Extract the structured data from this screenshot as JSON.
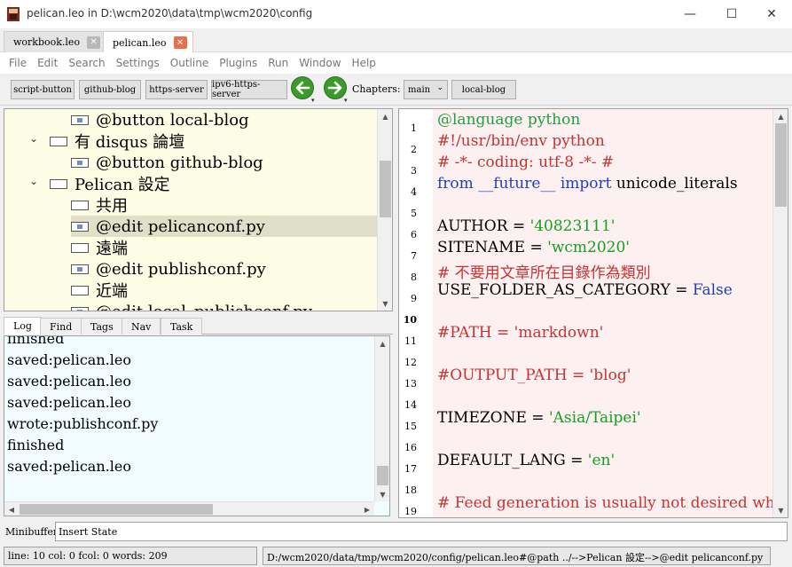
{
  "window": {
    "title": "pelican.leo in D:\\wcm2020\\data\\tmp\\wcm2020\\config",
    "minimize_glyph": "—",
    "maximize_glyph": "☐",
    "close_glyph": "✕"
  },
  "doc_tabs": [
    {
      "label": "workbook.leo",
      "close": "✕"
    },
    {
      "label": "pelican.leo",
      "close": "✕"
    }
  ],
  "menu": [
    "File",
    "Edit",
    "Search",
    "Settings",
    "Outline",
    "Plugins",
    "Run",
    "Window",
    "Help"
  ],
  "toolbar": {
    "buttons": [
      "script-button",
      "github-blog",
      "https-server",
      "ipv6-https-server"
    ],
    "chapters_label": "Chapters:",
    "chapter_select": "main",
    "chapter_button": "local-blog",
    "select_arrow": "⌄",
    "nav_drop": "▾"
  },
  "outline": {
    "nodes": [
      {
        "twisty": "",
        "icon": "body",
        "text": "@button local-blog"
      },
      {
        "twisty": "⌄",
        "icon": "empty",
        "text": "有 disqus 論壇"
      },
      {
        "twisty": "",
        "icon": "body",
        "text": "@button github-blog"
      },
      {
        "twisty": "⌄",
        "icon": "empty",
        "text": "Pelican 設定"
      },
      {
        "twisty": "",
        "icon": "empty",
        "text": "共用"
      },
      {
        "twisty": "",
        "icon": "body",
        "text": "@edit pelicanconf.py"
      },
      {
        "twisty": "",
        "icon": "empty",
        "text": "遠端"
      },
      {
        "twisty": "",
        "icon": "body",
        "text": "@edit publishconf.py"
      },
      {
        "twisty": "",
        "icon": "empty",
        "text": "近端"
      },
      {
        "twisty": "",
        "icon": "body",
        "text": "@edit local_publishconf.py"
      }
    ],
    "selected_index": 5,
    "scroll": {
      "up": "▲",
      "down": "▼"
    }
  },
  "log_tabs": [
    "Log",
    "Find",
    "Tags",
    "Nav",
    "Task"
  ],
  "log": {
    "lines": [
      "finished",
      "saved:pelican.leo",
      "saved:pelican.leo",
      "saved:pelican.leo",
      "wrote:publishconf.py",
      "finished",
      "saved:pelican.leo"
    ],
    "scroll": {
      "up": "▲",
      "down": "▼",
      "left": "◀",
      "right": "▶"
    }
  },
  "body": {
    "line_numbers": [
      "1",
      "2",
      "3",
      "4",
      "5",
      "6",
      "7",
      "8",
      "9",
      "10",
      "11",
      "12",
      "13",
      "14",
      "15",
      "16",
      "17",
      "18",
      "19"
    ],
    "current_line": "10",
    "lines": [
      [
        {
          "t": "@language python",
          "c": "dir"
        }
      ],
      [
        {
          "t": "#!/usr/bin/env python",
          "c": "com"
        }
      ],
      [
        {
          "t": "# -*- coding: utf-8 -*- #",
          "c": "com"
        }
      ],
      [
        {
          "t": "from",
          "c": "kw"
        },
        {
          "t": " ",
          "c": "txt"
        },
        {
          "t": "__future__",
          "c": "kw"
        },
        {
          "t": " ",
          "c": "txt"
        },
        {
          "t": "import",
          "c": "kw"
        },
        {
          "t": " unicode_literals",
          "c": "txt"
        }
      ],
      [],
      [
        {
          "t": "AUTHOR = ",
          "c": "txt"
        },
        {
          "t": "'40823111'",
          "c": "str"
        }
      ],
      [
        {
          "t": "SITENAME = ",
          "c": "txt"
        },
        {
          "t": "'wcm2020'",
          "c": "str"
        }
      ],
      [
        {
          "t": "# 不要用文章所在目錄作為類別",
          "c": "com"
        }
      ],
      [
        {
          "t": "USE_FOLDER_AS_CATEGORY = ",
          "c": "txt"
        },
        {
          "t": "False",
          "c": "kw"
        }
      ],
      [],
      [
        {
          "t": "#PATH = 'markdown'",
          "c": "com"
        }
      ],
      [],
      [
        {
          "t": "#OUTPUT_PATH = 'blog'",
          "c": "com"
        }
      ],
      [],
      [
        {
          "t": "TIMEZONE = ",
          "c": "txt"
        },
        {
          "t": "'Asia/Taipei'",
          "c": "str"
        }
      ],
      [],
      [
        {
          "t": "DEFAULT_LANG = ",
          "c": "txt"
        },
        {
          "t": "'en'",
          "c": "str"
        }
      ],
      [],
      [
        {
          "t": "# Feed generation is usually not desired when",
          "c": "com"
        }
      ]
    ],
    "scroll": {
      "up": "▲",
      "down": "▼"
    }
  },
  "minibuffer": {
    "label": "Minibuffer:",
    "value": "Insert State"
  },
  "status": {
    "left": "line: 10 col: 0  fcol: 0 words: 209",
    "right": "D:/wcm2020/data/tmp/wcm2020/config/pelican.leo#@path ../-->Pelican 設定-->@edit pelicanconf.py"
  }
}
